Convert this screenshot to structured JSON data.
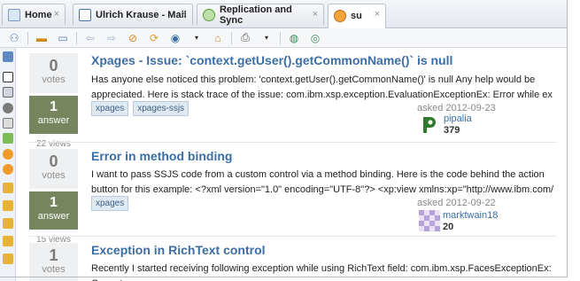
{
  "tabs": [
    {
      "label": "Home",
      "icon": "home-icon"
    },
    {
      "label": "Ulrich Krause - Mail",
      "icon": "mail-icon"
    },
    {
      "label": "Replication and Sync",
      "icon": "replication-icon"
    },
    {
      "label": "su",
      "icon": "stackoverflow-icon"
    }
  ],
  "tab_close_glyph": "×",
  "questions": [
    {
      "votes": "0",
      "votes_label": "votes",
      "answers": "1",
      "answers_label": "answer",
      "views": "22 views",
      "title": "Xpages - Issue: `context.getUser().getCommonName()` is null",
      "excerpt": "Has anyone else noticed this problem: 'context.getUser().getCommonName()' is null Any help would be appreciated. Here is stack trace of the issue: com.ibm.xsp.exception.EvaluationExceptionEx: Error while ex",
      "tags": [
        "xpages",
        "xpages-ssjs"
      ],
      "asked": "asked 2012-09-23",
      "user": "pipalia",
      "reputation": "379"
    },
    {
      "votes": "0",
      "votes_label": "votes",
      "answers": "1",
      "answers_label": "answer",
      "views": "15 views",
      "title": "Error in method binding",
      "excerpt": "I want to pass SSJS code from a custom control via a method binding. Here is the code behind the action button for this example: <?xml version=\"1.0\" encoding=\"UTF-8\"?> <xp:view xmlns:xp=\"http://www.ibm.com/",
      "tags": [
        "xpages"
      ],
      "asked": "asked 2012-09-22",
      "user": "marktwain18",
      "reputation": "20"
    },
    {
      "votes": "1",
      "votes_label": "votes",
      "title": "Exception in RichText control",
      "excerpt": "Recently I started receiving following exception while using RichText field: com.ibm.xsp.FacesExceptionEx: Cannot"
    }
  ],
  "colors": {
    "link": "#3a6ea5",
    "answered": "#76855d",
    "tag_bg": "#dfe9f2"
  }
}
